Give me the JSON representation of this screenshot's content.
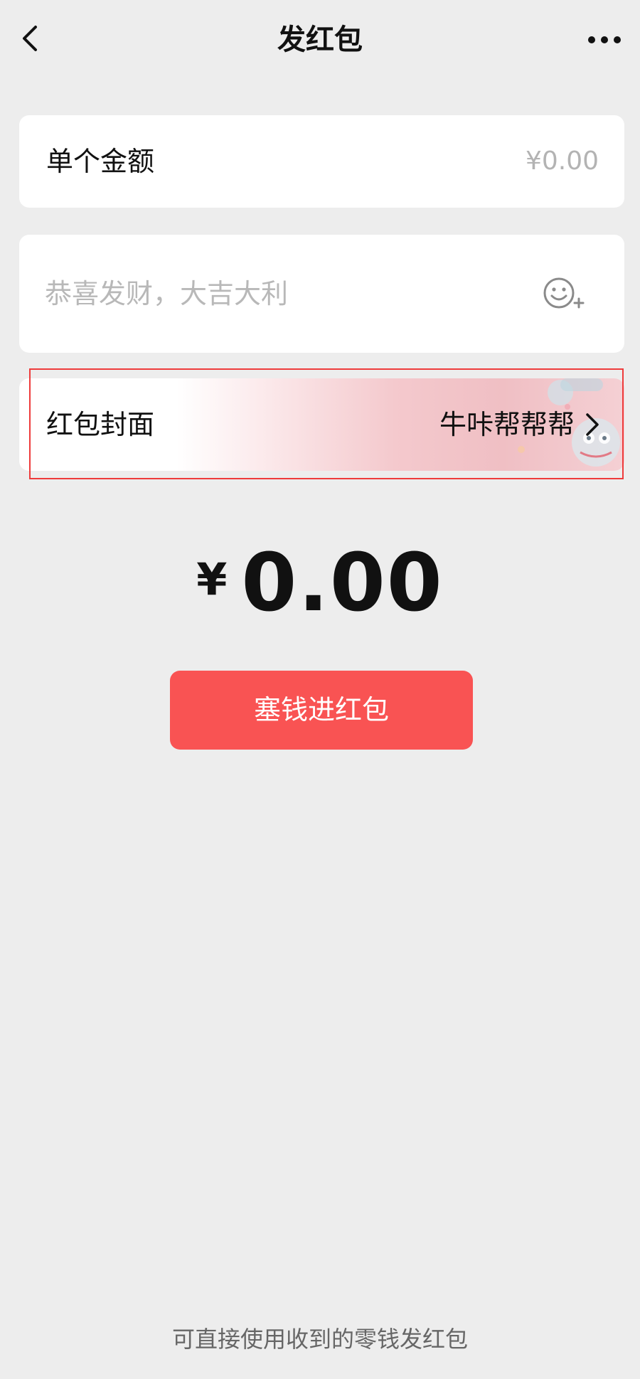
{
  "header": {
    "title": "发红包",
    "back_icon": "chevron-left-icon",
    "more_icon": "more-dots-icon"
  },
  "amount_row": {
    "label": "单个金额",
    "value": "¥0.00"
  },
  "message": {
    "placeholder": "恭喜发财，大吉大利",
    "emoji_icon": "emoji-add-icon"
  },
  "cover_row": {
    "label": "红包封面",
    "value": "牛咔帮帮帮",
    "chevron_icon": "chevron-right-icon"
  },
  "total": {
    "symbol": "¥",
    "amount": "0.00"
  },
  "submit": {
    "label": "塞钱进红包"
  },
  "footer": {
    "note": "可直接使用收到的零钱发红包"
  },
  "colors": {
    "background": "#ededed",
    "card": "#ffffff",
    "button": "#f95353",
    "highlight": "#ee3b3b"
  }
}
